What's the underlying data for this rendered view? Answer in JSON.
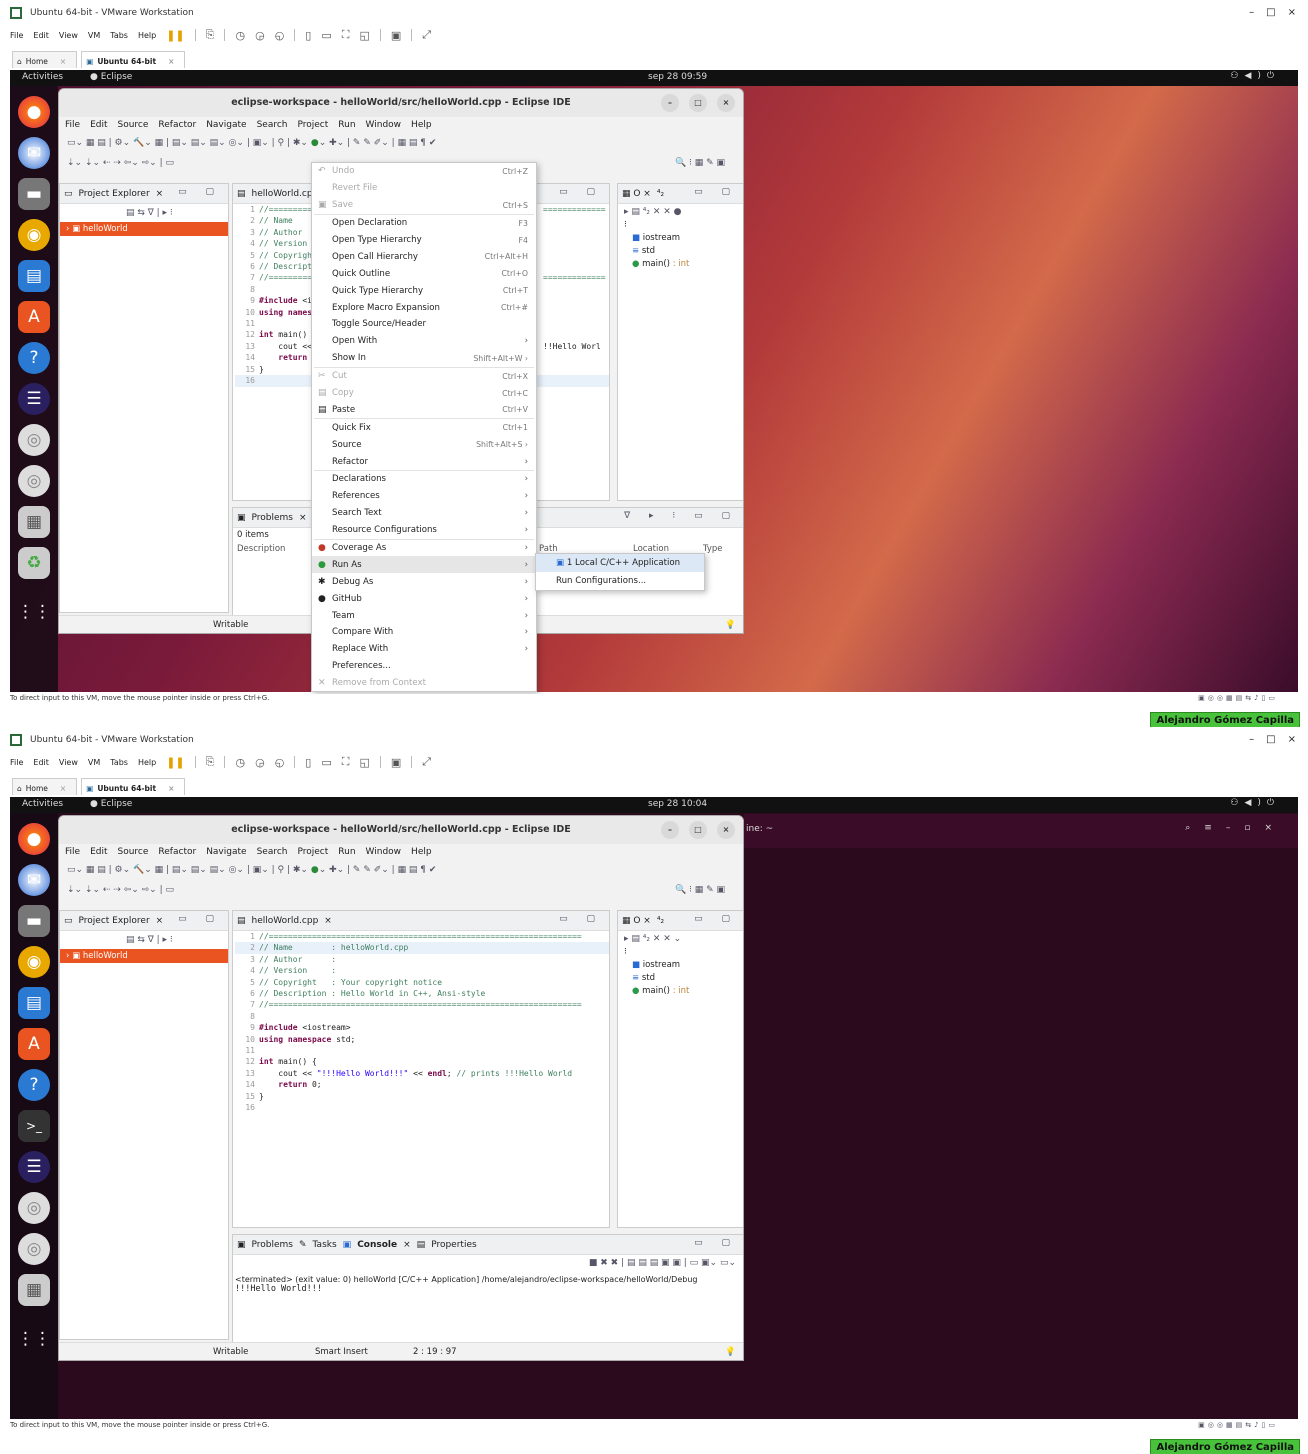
{
  "vmware": {
    "title": "Ubuntu 64-bit - VMware Workstation",
    "menu": [
      "File",
      "Edit",
      "View",
      "VM",
      "Tabs",
      "Help"
    ],
    "tabs": [
      {
        "label": "Home"
      },
      {
        "label": "Ubuntu 64-bit"
      }
    ],
    "status_text": "To direct input to this VM, move the mouse pointer inside or press Ctrl+G.",
    "user_tag": "Alejandro Gómez Capilla"
  },
  "gnome": {
    "activities": "Activities",
    "app_name": "Eclipse",
    "clock_1": "sep 28  09:59",
    "clock_2": "sep 28  10:04"
  },
  "eclipse": {
    "title": "eclipse-workspace - helloWorld/src/helloWorld.cpp - Eclipse IDE",
    "menu": [
      "File",
      "Edit",
      "Source",
      "Refactor",
      "Navigate",
      "Search",
      "Project",
      "Run",
      "Window",
      "Help"
    ],
    "project_explorer": {
      "tab": "Project Explorer",
      "project": "helloWorld"
    },
    "editor_tab_1": "helloWorld.cp",
    "editor_tab_2": "helloWorld.cpp",
    "outline_items": [
      {
        "name": "iostream",
        "type": ""
      },
      {
        "name": "std",
        "type": ""
      },
      {
        "name": "main()",
        "type": " : int"
      }
    ],
    "problems": {
      "tab": "Problems",
      "items": "0 items",
      "col_description": "Description",
      "col_path": "Path",
      "col_location": "Location",
      "col_type": "Type"
    },
    "bottom_tabs_2": [
      "Problems",
      "Tasks",
      "Console",
      "Properties"
    ],
    "console_header": "<terminated> (exit value: 0) helloWorld [C/C++ Application] /home/alejandro/eclipse-workspace/helloWorld/Debug",
    "console_output": "!!!Hello World!!!",
    "status_writable": "Writable",
    "status_insert": "Smart Insert",
    "status_pos": "2 : 19 : 97"
  },
  "code_lines": [
    "//=================================================================",
    "// Name        : helloWorld.cpp",
    "// Author      :",
    "// Version     :",
    "// Copyright   : Your copyright notice",
    "// Description : Hello World in C++, Ansi-style",
    "//=================================================================",
    "",
    "#include <iostream>",
    "using namespace std;",
    "",
    "int main() {",
    "    cout << \"!!!Hello World!!!\" << endl; // prints !!!Hello World",
    "    return 0;",
    "}",
    ""
  ],
  "context_menu": [
    {
      "label": "Undo",
      "shortcut": "Ctrl+Z",
      "disabled": true
    },
    {
      "label": "Revert File",
      "shortcut": "",
      "disabled": true
    },
    {
      "label": "Save",
      "shortcut": "Ctrl+S",
      "disabled": true
    },
    {
      "label": "Open Declaration",
      "shortcut": "F3"
    },
    {
      "label": "Open Type Hierarchy",
      "shortcut": "F4"
    },
    {
      "label": "Open Call Hierarchy",
      "shortcut": "Ctrl+Alt+H"
    },
    {
      "label": "Quick Outline",
      "shortcut": "Ctrl+O"
    },
    {
      "label": "Quick Type Hierarchy",
      "shortcut": "Ctrl+T"
    },
    {
      "label": "Explore Macro Expansion",
      "shortcut": "Ctrl+#"
    },
    {
      "label": "Toggle Source/Header",
      "shortcut": ""
    },
    {
      "label": "Open With",
      "shortcut": "",
      "submenu": true
    },
    {
      "label": "Show In",
      "shortcut": "Shift+Alt+W",
      "submenu": true
    },
    {
      "label": "Cut",
      "shortcut": "Ctrl+X",
      "disabled": true
    },
    {
      "label": "Copy",
      "shortcut": "Ctrl+C",
      "disabled": true
    },
    {
      "label": "Paste",
      "shortcut": "Ctrl+V"
    },
    {
      "label": "Quick Fix",
      "shortcut": "Ctrl+1"
    },
    {
      "label": "Source",
      "shortcut": "Shift+Alt+S",
      "submenu": true
    },
    {
      "label": "Refactor",
      "shortcut": "",
      "submenu": true
    },
    {
      "label": "Declarations",
      "shortcut": "",
      "submenu": true
    },
    {
      "label": "References",
      "shortcut": "",
      "submenu": true
    },
    {
      "label": "Search Text",
      "shortcut": "",
      "submenu": true
    },
    {
      "label": "Resource Configurations",
      "shortcut": "",
      "submenu": true
    },
    {
      "label": "Coverage As",
      "shortcut": "",
      "submenu": true
    },
    {
      "label": "Run As",
      "shortcut": "",
      "submenu": true,
      "selected": true
    },
    {
      "label": "Debug As",
      "shortcut": "",
      "submenu": true
    },
    {
      "label": "GitHub",
      "shortcut": "",
      "submenu": true
    },
    {
      "label": "Team",
      "shortcut": "",
      "submenu": true
    },
    {
      "label": "Compare With",
      "shortcut": "",
      "submenu": true
    },
    {
      "label": "Replace With",
      "shortcut": "",
      "submenu": true
    },
    {
      "label": "Preferences...",
      "shortcut": ""
    },
    {
      "label": "Remove from Context",
      "shortcut": "",
      "disabled": true
    }
  ],
  "run_as_submenu": [
    "1 Local C/C++ Application",
    "Run Configurations..."
  ],
  "colors": {
    "ubuntu_orange": "#e95420",
    "eclipse_bg": "#f2f2f2",
    "tag_green": "#48c23a"
  }
}
